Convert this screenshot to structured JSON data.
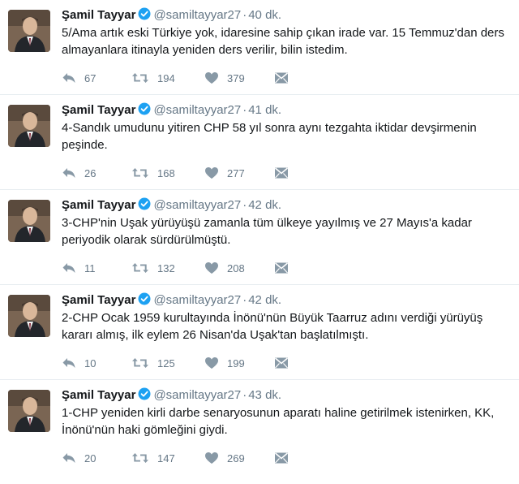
{
  "colors": {
    "verified": "#1da1f2",
    "meta": "#657786",
    "text": "#14171a",
    "divider": "#e6ecf0"
  },
  "icons": {
    "reply": "reply-icon",
    "retweet": "retweet-icon",
    "like": "heart-icon",
    "dm": "direct-message-icon",
    "verified": "verified-badge-icon"
  },
  "tweets": [
    {
      "name": "Şamil Tayyar",
      "handle": "@samiltayyar27",
      "separator": "·",
      "time": "40 dk.",
      "text": "5/Ama artık eski Türkiye yok, idaresine sahip çıkan irade var. 15 Temmuz'dan ders almayanlara itinayla yeniden ders verilir, bilin istedim.",
      "replies": "67",
      "retweets": "194",
      "likes": "379"
    },
    {
      "name": "Şamil Tayyar",
      "handle": "@samiltayyar27",
      "separator": "·",
      "time": "41 dk.",
      "text": "4-Sandık umudunu yitiren CHP 58 yıl sonra aynı tezgahta iktidar devşirmenin peşinde.",
      "replies": "26",
      "retweets": "168",
      "likes": "277"
    },
    {
      "name": "Şamil Tayyar",
      "handle": "@samiltayyar27",
      "separator": "·",
      "time": "42 dk.",
      "text": "3-CHP'nin Uşak yürüyüşü zamanla tüm ülkeye yayılmış ve 27 Mayıs'a kadar periyodik olarak sürdürülmüştü.",
      "replies": "11",
      "retweets": "132",
      "likes": "208"
    },
    {
      "name": "Şamil Tayyar",
      "handle": "@samiltayyar27",
      "separator": "·",
      "time": "42 dk.",
      "text": "2-CHP Ocak 1959 kurultayında İnönü'nün Büyük Taarruz adını verdiği yürüyüş kararı almış, ilk eylem 26 Nisan'da Uşak'tan başlatılmıştı.",
      "replies": "10",
      "retweets": "125",
      "likes": "199"
    },
    {
      "name": "Şamil Tayyar",
      "handle": "@samiltayyar27",
      "separator": "·",
      "time": "43 dk.",
      "text": "1-CHP yeniden kirli darbe senaryosunun aparatı haline getirilmek istenirken, KK, İnönü'nün haki gömleğini giydi.",
      "replies": "20",
      "retweets": "147",
      "likes": "269"
    }
  ]
}
